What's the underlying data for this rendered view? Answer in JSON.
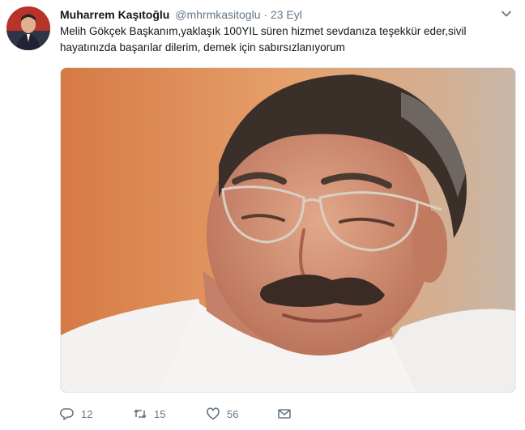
{
  "tweet": {
    "display_name": "Muharrem Kaşıtoğlu",
    "handle": "@mhrmkasitoglu",
    "separator": "·",
    "date": "23 Eyl",
    "text": "Melih Gökçek Başkanım,yaklaşık 100YIL süren hizmet sevdanıza teşekkür eder,sivil hayatınızda başarılar dilerim, demek için sabırsızlanıyorum"
  },
  "actions": {
    "reply_count": "12",
    "retweet_count": "15",
    "like_count": "56"
  },
  "icons": {
    "reply": "reply-icon",
    "retweet": "retweet-icon",
    "like": "heart-icon",
    "dm": "envelope-icon",
    "caret": "chevron-down-icon"
  },
  "colors": {
    "text": "#14171a",
    "muted": "#657786",
    "border": "#e1e8ed"
  }
}
